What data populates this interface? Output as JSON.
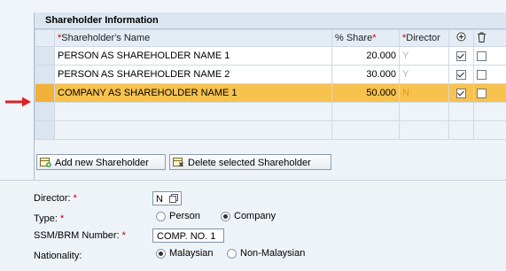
{
  "section_title": "Shareholder Information",
  "table": {
    "headers": {
      "name_req": "*",
      "name": "Shareholder's Name",
      "share": "% Share",
      "share_req": "*",
      "director_req": "*",
      "director": "Director"
    },
    "rows": [
      {
        "name": "PERSON AS SHAREHOLDER NAME 1",
        "share": "20.000",
        "director": "Y",
        "checked": true
      },
      {
        "name": "PERSON AS SHAREHOLDER NAME 2",
        "share": "30.000",
        "director": "Y",
        "checked": true
      },
      {
        "name": "COMPANY AS SHAREHOLDER NAME 1",
        "share": "50.000",
        "director": "N",
        "checked": true
      }
    ]
  },
  "buttons": {
    "add": "Add new Shareholder",
    "delete": "Delete selected Shareholder"
  },
  "form": {
    "director_label": "Director:",
    "director_value": "N",
    "type_label": "Type:",
    "type_options": [
      "Person",
      "Company"
    ],
    "type_selected": "Company",
    "ssm_label": "SSM/BRM Number:",
    "ssm_value": "COMP. NO. 1",
    "nationality_label": "Nationality:",
    "nationality_options": [
      "Malaysian",
      "Non-Malaysian"
    ],
    "nationality_selected": "Malaysian",
    "required_mark": "*"
  },
  "colors": {
    "highlight": "#f8c24e",
    "required": "#c00000",
    "arrow": "#e02020"
  }
}
